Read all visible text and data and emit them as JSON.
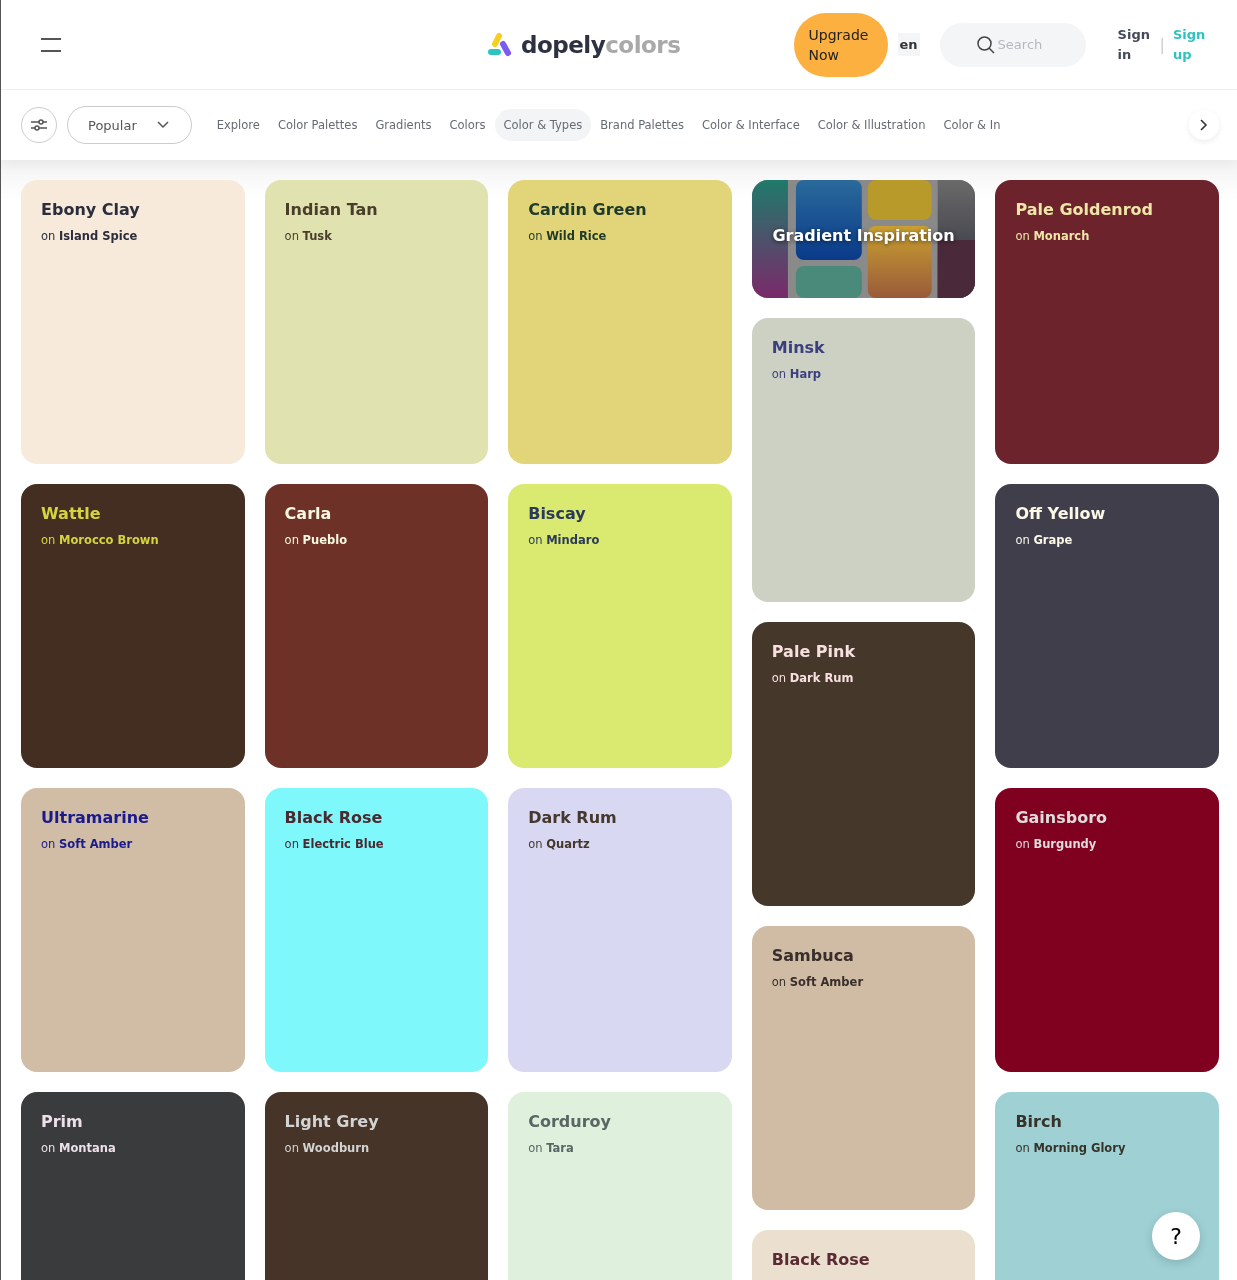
{
  "header": {
    "logo": {
      "name": "dopely",
      "suffix": "colors"
    },
    "upgrade_button": "Upgrade Now",
    "language": "en",
    "search": {
      "placeholder": "Search"
    },
    "sign_in": "Sign in",
    "separator": "|",
    "sign_up": "Sign up"
  },
  "filter_bar": {
    "sort_dropdown": "Popular",
    "tabs": [
      {
        "label": "Explore",
        "selected": false
      },
      {
        "label": "Color Palettes",
        "selected": false
      },
      {
        "label": "Gradients",
        "selected": false
      },
      {
        "label": "Colors",
        "selected": false
      },
      {
        "label": "Color & Types",
        "selected": true
      },
      {
        "label": "Brand Palettes",
        "selected": false
      },
      {
        "label": "Color & Interface",
        "selected": false
      },
      {
        "label": "Color & Illustration",
        "selected": false
      },
      {
        "label": "Color & In",
        "selected": false
      }
    ]
  },
  "columns": [
    {
      "cards": [
        {
          "kind": "pair",
          "title": "Ebony Clay",
          "subtitle": "on **Island Spice**",
          "color": "#f7eadb",
          "text": {
            "color": "#2b2d3d"
          }
        },
        {
          "kind": "pair",
          "title": "Wattle",
          "subtitle": "on **Morocco Brown**",
          "color": "#432e21",
          "text": {
            "color": "#d6d43e"
          }
        },
        {
          "kind": "pair",
          "title": "Ultramarine",
          "subtitle": "on **Soft Amber**",
          "color": "#d1bca5",
          "text": {
            "color": "#1a1a8f"
          }
        },
        {
          "kind": "pair",
          "title": "Prim",
          "subtitle": "on **Montana**",
          "color": "#3a3b3d",
          "text": {
            "color": "#eee0ea"
          }
        }
      ]
    },
    {
      "cards": [
        {
          "kind": "pair",
          "title": "Indian Tan",
          "subtitle": "on **Tusk**",
          "color": "#e0e3b0",
          "text": {
            "color": "#4a3d2a"
          }
        },
        {
          "kind": "pair",
          "title": "Carla",
          "subtitle": "on **Pueblo**",
          "color": "#6e3127",
          "text": {
            "color": "#f4f8e1"
          }
        },
        {
          "kind": "pair",
          "title": "Black Rose",
          "subtitle": "on **Electric Blue**",
          "color": "#7ef8fb",
          "text": {
            "color": "#4a2a30"
          }
        },
        {
          "kind": "pair",
          "title": "Light Grey",
          "subtitle": "on **Woodburn**",
          "color": "#453427",
          "text": {
            "color": "#d3d3d3"
          }
        }
      ]
    },
    {
      "cards": [
        {
          "kind": "pair",
          "title": "Cardin Green",
          "subtitle": "on **Wild Rice**",
          "color": "#e2d478",
          "text": {
            "color": "#1f3a2a"
          }
        },
        {
          "kind": "pair",
          "title": "Biscay",
          "subtitle": "on **Mindaro**",
          "color": "#dae96f",
          "text": {
            "color": "#2a3a5a"
          }
        },
        {
          "kind": "pair",
          "title": "Dark Rum",
          "subtitle": "on **Quartz**",
          "color": "#d9d8f2",
          "text": {
            "color": "#45382f"
          }
        },
        {
          "kind": "pair",
          "title": "Corduroy",
          "subtitle": "on **Tara**",
          "color": "#dff0dc",
          "text": {
            "color": "#5a6664"
          }
        }
      ]
    },
    {
      "cards": [
        {
          "kind": "gradient",
          "title": "Gradient Inspiration"
        },
        {
          "kind": "pair",
          "title": "Minsk",
          "subtitle": "on **Harp**",
          "color": "#cdd1c4",
          "text": {
            "color": "#3b3f80"
          }
        },
        {
          "kind": "pair",
          "title": "Pale Pink",
          "subtitle": "on **Dark Rum**",
          "color": "#45382b",
          "text": {
            "color": "#f8e0e0"
          }
        },
        {
          "kind": "pair",
          "title": "Sambuca",
          "subtitle": "on **Soft Amber**",
          "color": "#d0bca4",
          "text": {
            "color": "#3a2e2c"
          }
        },
        {
          "kind": "pair",
          "title": "Black Rose",
          "color": "#ebe0cf",
          "text": {
            "color": "#5a2a35"
          }
        }
      ]
    },
    {
      "cards": [
        {
          "kind": "pair",
          "title": "Pale Goldenrod",
          "subtitle": "on **Monarch**",
          "color": "#6d232b",
          "text": {
            "color": "#ede6a8"
          }
        },
        {
          "kind": "pair",
          "title": "Off Yellow",
          "subtitle": "on **Grape**",
          "color": "#413e4c",
          "text": {
            "color": "#fbf8e8"
          }
        },
        {
          "kind": "pair",
          "title": "Gainsboro",
          "subtitle": "on **Burgundy**",
          "color": "#800020",
          "text": {
            "color": "#dcdcdc"
          }
        },
        {
          "kind": "pair",
          "title": "Birch",
          "subtitle": "on **Morning Glory**",
          "color": "#9ed0d4",
          "text": {
            "color": "#373328"
          }
        }
      ]
    }
  ],
  "help_button": "?"
}
